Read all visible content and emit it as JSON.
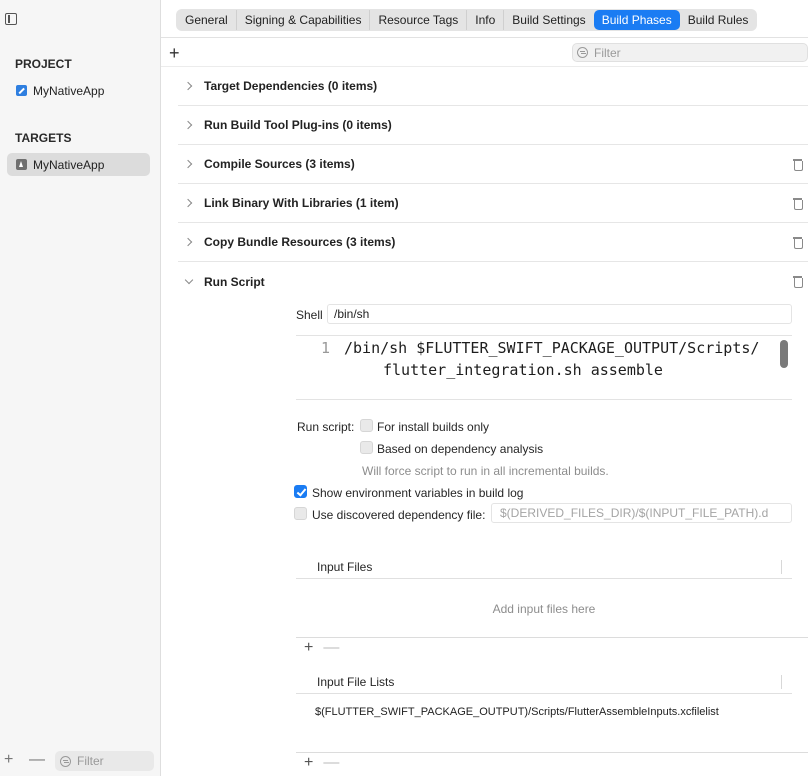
{
  "sidebar": {
    "project_header": "PROJECT",
    "project_item": "MyNativeApp",
    "targets_header": "TARGETS",
    "target_item": "MyNativeApp",
    "filter_placeholder": "Filter"
  },
  "tabs": [
    "General",
    "Signing & Capabilities",
    "Resource Tags",
    "Info",
    "Build Settings",
    "Build Phases",
    "Build Rules"
  ],
  "active_tab": "Build Phases",
  "toolbar": {
    "add_symbol": "+",
    "filter_placeholder": "Filter"
  },
  "phases": [
    "Target Dependencies (0 items)",
    "Run Build Tool Plug-ins (0 items)",
    "Compile Sources (3 items)",
    "Link Binary With Libraries (1 item)",
    "Copy Bundle Resources (3 items)",
    "Run Script"
  ],
  "run_script": {
    "shell_label": "Shell",
    "shell_value": "/bin/sh",
    "line_number": "1",
    "script": "/bin/sh $FLUTTER_SWIFT_PACKAGE_OUTPUT/Scripts/ flutter_integration.sh assemble",
    "run_script_label": "Run script:",
    "install_builds_only": {
      "label": "For install builds only",
      "checked": false
    },
    "dependency_analysis": {
      "label": "Based on dependency analysis",
      "checked": false
    },
    "dependency_hint": "Will force script to run in all incremental builds.",
    "show_env_vars": {
      "label": "Show environment variables in build log",
      "checked": true
    },
    "use_dep_file": {
      "label": "Use discovered dependency file:",
      "checked": false
    },
    "dep_file_placeholder": "$(DERIVED_FILES_DIR)/$(INPUT_FILE_PATH).d",
    "input_files": {
      "header": "Input Files",
      "empty_message": "Add input files here"
    },
    "input_file_lists": {
      "header": "Input File Lists",
      "items": [
        "$(FLUTTER_SWIFT_PACKAGE_OUTPUT)/Scripts/FlutterAssembleInputs.xcfilelist"
      ]
    },
    "add_symbol": "+",
    "remove_symbol": "—"
  },
  "colors": {
    "accent": "#1a7cf3",
    "sidebar_bg": "#f6f6f6"
  }
}
